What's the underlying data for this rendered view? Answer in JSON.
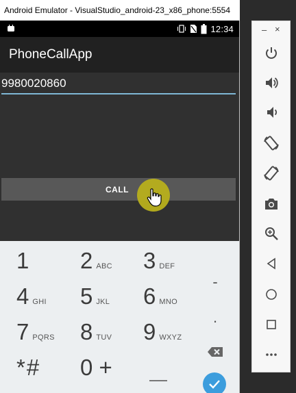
{
  "window": {
    "title": "Android Emulator - VisualStudio_android-23_x86_phone:5554"
  },
  "statusbar": {
    "time": "12:34",
    "icons": [
      "android-notification-icon",
      "vibrate-icon",
      "no-sim-icon",
      "battery-icon"
    ]
  },
  "app": {
    "title": "PhoneCallApp",
    "phone_number": "9980020860",
    "call_label": "CALL"
  },
  "keypad": {
    "keys": [
      {
        "digit": "1",
        "letters": ""
      },
      {
        "digit": "2",
        "letters": "ABC"
      },
      {
        "digit": "3",
        "letters": "DEF"
      },
      {
        "digit": "4",
        "letters": "GHI"
      },
      {
        "digit": "5",
        "letters": "JKL"
      },
      {
        "digit": "6",
        "letters": "MNO"
      },
      {
        "digit": "7",
        "letters": "PQRS"
      },
      {
        "digit": "8",
        "letters": "TUV"
      },
      {
        "digit": "9",
        "letters": "WXYZ"
      },
      {
        "digit": "*#",
        "letters": ""
      },
      {
        "digit": "0 +",
        "letters": ""
      }
    ],
    "dash": "-",
    "dot": ".",
    "underscore": "__"
  },
  "colors": {
    "accent": "#3c9ddd",
    "touch": "#b8b01c",
    "input_underline": "#7fb8d6"
  },
  "toolbar": {
    "minimize": "–",
    "close": "×",
    "buttons": [
      "power-icon",
      "volume-up-icon",
      "volume-down-icon",
      "rotate-left-icon",
      "rotate-right-icon",
      "camera-icon",
      "zoom-icon",
      "back-icon",
      "home-icon",
      "overview-icon",
      "more-icon"
    ]
  }
}
